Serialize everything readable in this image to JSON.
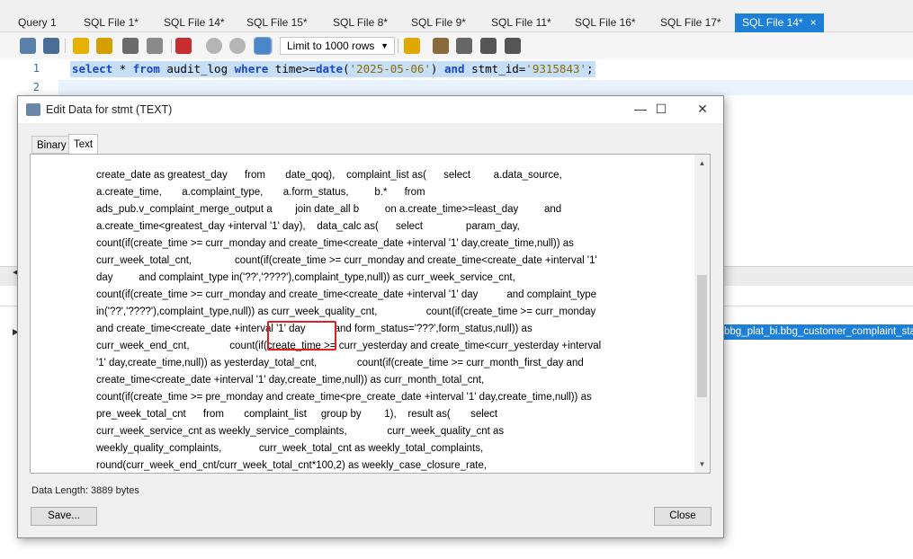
{
  "tabs": [
    {
      "label": "Query 1"
    },
    {
      "label": "SQL File 1*"
    },
    {
      "label": "SQL File 14*"
    },
    {
      "label": "SQL File 15*"
    },
    {
      "label": "SQL File 8*"
    },
    {
      "label": "SQL File 9*"
    },
    {
      "label": "SQL File 11*"
    },
    {
      "label": "SQL File 16*"
    },
    {
      "label": "SQL File 17*"
    },
    {
      "label": "SQL File 14*",
      "active": true
    }
  ],
  "toolbar": {
    "limit_label": "Limit to 1000 rows",
    "icons": [
      "open-folder-icon",
      "save-icon",
      "execute-icon",
      "execute-current-icon",
      "explain-icon",
      "stop-icon",
      "toggle-error-icon",
      "commit-icon",
      "rollback-icon",
      "autocommit-icon",
      "bookmark-icon",
      "beautify-icon",
      "find-icon",
      "invisible-chars-icon",
      "wrap-icon"
    ]
  },
  "editor": {
    "line_numbers": [
      "1",
      "2"
    ],
    "query_tokens": [
      {
        "t": "select",
        "k": "kw"
      },
      {
        "t": " * ",
        "k": ""
      },
      {
        "t": "from",
        "k": "kw"
      },
      {
        "t": " audit_log ",
        "k": ""
      },
      {
        "t": "where",
        "k": "kw"
      },
      {
        "t": " time>=",
        "k": ""
      },
      {
        "t": "date",
        "k": "kw"
      },
      {
        "t": "(",
        "k": ""
      },
      {
        "t": "'2025-05-06'",
        "k": "str"
      },
      {
        "t": ") ",
        "k": ""
      },
      {
        "t": "and",
        "k": "kw"
      },
      {
        "t": " stmt_id=",
        "k": ""
      },
      {
        "t": "'9315843'",
        "k": "str"
      },
      {
        "t": ";",
        "k": ""
      }
    ]
  },
  "background": {
    "highlighted_cell": "bbg_plat_bi.bbg_customer_complaint_statis"
  },
  "dialog": {
    "title": "Edit Data for stmt (TEXT)",
    "tabs": {
      "binary": "Binary",
      "text": "Text"
    },
    "text_lines": [
      "create_date as greatest_day      from       date_qoq),    complaint_list as(      select        a.data_source,",
      "a.create_time,       a.complaint_type,       a.form_status,         b.*      from",
      "ads_pub.v_complaint_merge_output a        join date_all b         on a.create_time>=least_day         and",
      "a.create_time<greatest_day +interval '1' day),    data_calc as(      select               param_day,",
      "count(if(create_time >= curr_monday and create_time<create_date +interval '1' day,create_time,null)) as",
      "curr_week_total_cnt,               count(if(create_time >= curr_monday and create_time<create_date +interval '1'",
      "day         and complaint_type in('??','????'),complaint_type,null)) as curr_week_service_cnt,",
      "count(if(create_time >= curr_monday and create_time<create_date +interval '1' day          and complaint_type",
      "in('??','????'),complaint_type,null)) as curr_week_quality_cnt,                 count(if(create_time >= curr_monday",
      "and create_time<create_date +interval '1' day          and form_status='???',form_status,null)) as",
      "curr_week_end_cnt,              count(if(create_time >= curr_yesterday and create_time<curr_yesterday +interval",
      "'1' day,create_time,null)) as yesterday_total_cnt,              count(if(create_time >= curr_month_first_day and",
      "create_time<create_date +interval '1' day,create_time,null)) as curr_month_total_cnt,",
      "count(if(create_time >= pre_monday and create_time<pre_create_date +interval '1' day,create_time,null)) as",
      "pre_week_total_cnt      from       complaint_list     group by        1),    result as(       select",
      "curr_week_service_cnt as weekly_service_complaints,              curr_week_quality_cnt as",
      "weekly_quality_complaints,             curr_week_total_cnt as weekly_total_complaints,",
      "round(curr_week_end_cnt/curr_week_total_cnt*100,2) as weekly_case_closure_rate,"
    ],
    "data_length": "Data Length: 3889 bytes",
    "save_label": "Save...",
    "close_label": "Close"
  }
}
